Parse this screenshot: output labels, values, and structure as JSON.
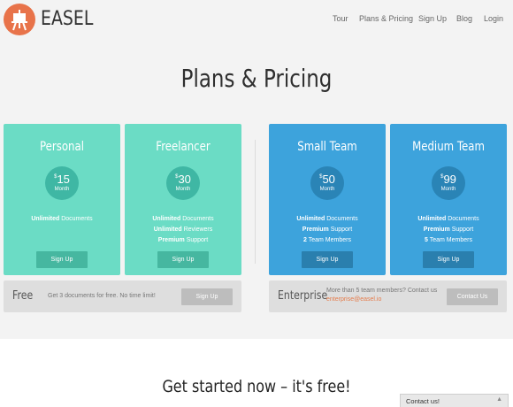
{
  "brand": {
    "name": "EASEL",
    "logo_color": "#e8734a"
  },
  "nav": {
    "tour": "Tour",
    "pricing": "Plans & Pricing",
    "signup": "Sign Up",
    "blog": "Blog",
    "login": "Login"
  },
  "page_title": "Plans & Pricing",
  "plans": [
    {
      "name": "Personal",
      "currency": "$",
      "price": "15",
      "unit": "Month",
      "features": [
        {
          "bold": "Unlimited",
          "text": " Documents"
        }
      ],
      "button": "Sign Up",
      "color": "#6bdcc5"
    },
    {
      "name": "Freelancer",
      "currency": "$",
      "price": "30",
      "unit": "Month",
      "features": [
        {
          "bold": "Unlimited",
          "text": " Documents"
        },
        {
          "bold": "Unlimited",
          "text": " Reviewers"
        },
        {
          "bold": "Premium",
          "text": " Support"
        }
      ],
      "button": "Sign Up",
      "color": "#6bdcc5"
    },
    {
      "name": "Small Team",
      "currency": "$",
      "price": "50",
      "unit": "Month",
      "features": [
        {
          "bold": "Unlimited",
          "text": " Documents"
        },
        {
          "bold": "Premium",
          "text": " Support"
        },
        {
          "bold": "2",
          "text": " Team Members"
        }
      ],
      "button": "Sign Up",
      "color": "#3da3dc"
    },
    {
      "name": "Medium Team",
      "currency": "$",
      "price": "99",
      "unit": "Month",
      "features": [
        {
          "bold": "Unlimited",
          "text": " Documents"
        },
        {
          "bold": "Premium",
          "text": " Support"
        },
        {
          "bold": "5",
          "text": " Team Members"
        }
      ],
      "button": "Sign Up",
      "color": "#3da3dc"
    }
  ],
  "free": {
    "title": "Free",
    "text": "Get 3 documents for free. No time limit!",
    "button": "Sign Up"
  },
  "enterprise": {
    "title": "Enterprise",
    "text": "More than 5 team members? Contact us",
    "email": "enterprise@easel.io",
    "button": "Contact Us"
  },
  "cta": "Get started now – it's free!",
  "contact_widget": {
    "label": "Contact us!",
    "icon": "chevron-up-icon"
  }
}
